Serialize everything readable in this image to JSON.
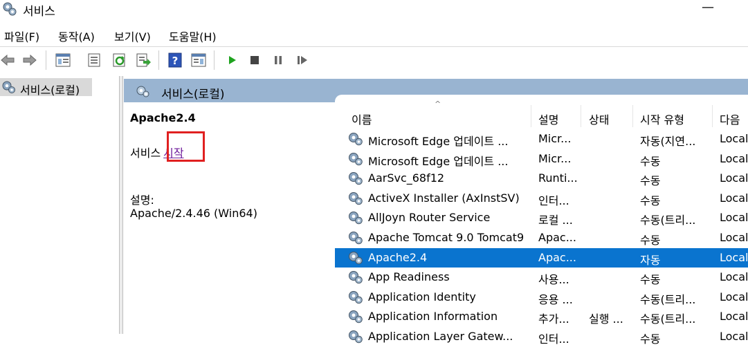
{
  "window": {
    "title": "서비스",
    "minimize_glyph": "—"
  },
  "menu": [
    "파일(F)",
    "동작(A)",
    "보기(V)",
    "도움말(H)"
  ],
  "toolbar_icons": [
    "back-arrow-icon",
    "forward-arrow-icon",
    "show-hide-tree-icon",
    "properties-icon",
    "refresh-icon",
    "export-list-icon",
    "help-icon",
    "show-hide-action-pane-icon",
    "play-icon",
    "stop-icon",
    "pause-icon",
    "resume-icon"
  ],
  "tree": {
    "label": "서비스(로컬)"
  },
  "panel": {
    "header": "서비스(로컬)"
  },
  "detail": {
    "service_name": "Apache2.4",
    "action_prefix": "서비스",
    "action_link": "시작",
    "description_label": "설명:",
    "description": "Apache/2.4.46 (Win64)"
  },
  "columns": [
    "이름",
    "설명",
    "상태",
    "시작 유형",
    "다음"
  ],
  "rows": [
    [
      "Microsoft Edge 업데이트 ...",
      "Micr...",
      "",
      "자동(지연...",
      "Local"
    ],
    [
      "Microsoft Edge 업데이트 ...",
      "Micr...",
      "",
      "수동",
      "Local"
    ],
    [
      "AarSvc_68f12",
      "Runti...",
      "",
      "수동",
      "Local"
    ],
    [
      "ActiveX Installer (AxInstSV)",
      "인터...",
      "",
      "수동",
      "Local"
    ],
    [
      "AllJoyn Router Service",
      "로컬 ...",
      "",
      "수동(트리...",
      "Local"
    ],
    [
      "Apache Tomcat 9.0 Tomcat9",
      "Apac...",
      "",
      "수동",
      "Local"
    ],
    [
      "Apache2.4",
      "Apac...",
      "",
      "자동",
      "Local"
    ],
    [
      "App Readiness",
      "사용...",
      "",
      "수동",
      "Local"
    ],
    [
      "Application Identity",
      "응용 ...",
      "",
      "수동(트리...",
      "Local"
    ],
    [
      "Application Information",
      "추가...",
      "실행 ...",
      "수동(트리...",
      "Local"
    ],
    [
      "Application Layer Gatew...",
      "인터...",
      "",
      "수동",
      "Local"
    ]
  ],
  "selected_row": 6,
  "colors": {
    "selection": "#0a74cf",
    "header_band": "#99b4d1",
    "link": "#6d1a9a",
    "highlight_box": "#e02020"
  }
}
